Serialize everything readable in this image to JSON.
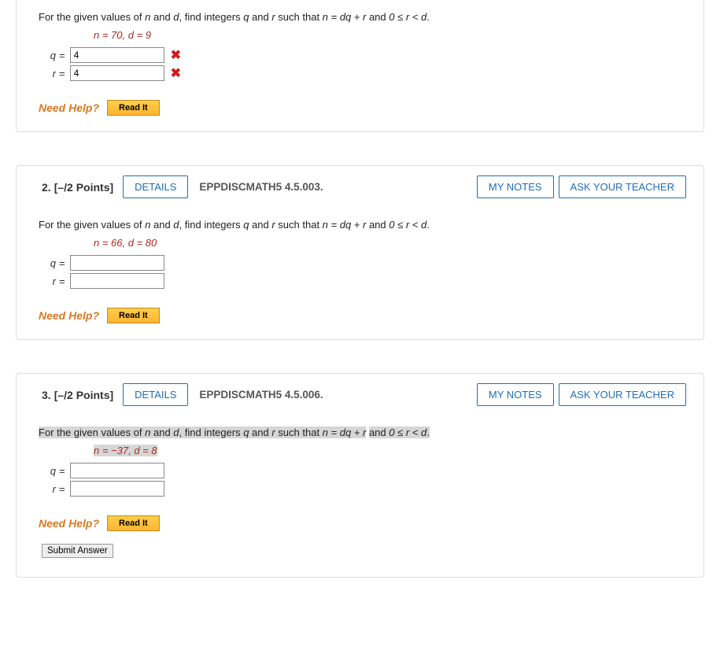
{
  "labels": {
    "details": "DETAILS",
    "myNotes": "MY NOTES",
    "askTeacher": "ASK YOUR TEACHER",
    "needHelp": "Need Help?",
    "readIt": "Read It",
    "submitAnswer": "Submit Answer",
    "qLabel": "q",
    "rLabel": "r",
    "equals": "="
  },
  "questions": [
    {
      "number": "",
      "points": "",
      "topicId": "",
      "showHeader": false,
      "promptParts": {
        "p1": "For the given values of ",
        "n": "n",
        "p2": " and ",
        "d": "d",
        "p3": ", find integers ",
        "q": "q",
        "p4": " and ",
        "r": "r",
        "p5": " such that ",
        "eq": "n = dq + r",
        "p6": " and ",
        "ineq": "0 ≤ r < d",
        "p7": "."
      },
      "highlighted": false,
      "params": "n = 70, d = 9",
      "qValue": "4",
      "rValue": "4",
      "qMark": "x",
      "rMark": "x",
      "showSubmit": false
    },
    {
      "number": "2.",
      "points": "[–/2 Points]",
      "topicId": "EPPDISCMATH5 4.5.003.",
      "showHeader": true,
      "promptParts": {
        "p1": "For the given values of ",
        "n": "n",
        "p2": " and ",
        "d": "d",
        "p3": ", find integers ",
        "q": "q",
        "p4": " and ",
        "r": "r",
        "p5": " such that ",
        "eq": "n = dq + r",
        "p6": " and ",
        "ineq": "0 ≤ r < d",
        "p7": "."
      },
      "highlighted": false,
      "params": "n = 66, d = 80",
      "qValue": "",
      "rValue": "",
      "qMark": "",
      "rMark": "",
      "showSubmit": false
    },
    {
      "number": "3.",
      "points": "[–/2 Points]",
      "topicId": "EPPDISCMATH5 4.5.006.",
      "showHeader": true,
      "promptParts": {
        "p1": "For the given values of ",
        "n": "n",
        "p2": " and ",
        "d": "d",
        "p3": ", find integers ",
        "q": "q",
        "p4": " and ",
        "r": "r",
        "p5": " such that ",
        "eq": "n = dq + r",
        "p6": " and ",
        "ineq": "0 ≤ r < d",
        "p7": "."
      },
      "highlighted": true,
      "params": "n = −37, d = 8",
      "qValue": "",
      "rValue": "",
      "qMark": "",
      "rMark": "",
      "showSubmit": true
    }
  ]
}
